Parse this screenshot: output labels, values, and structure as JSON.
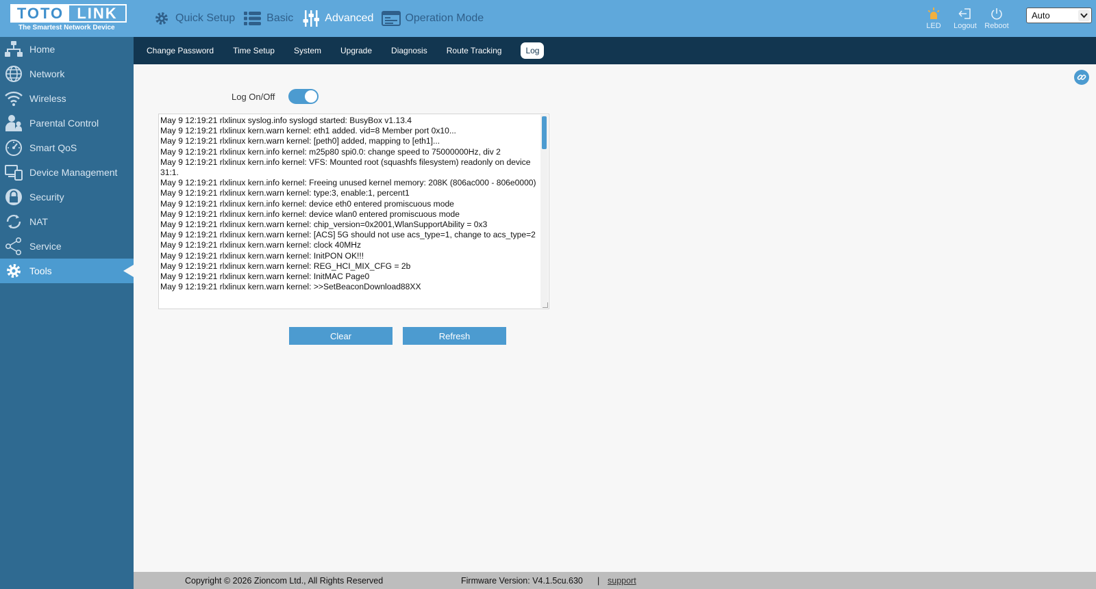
{
  "logo": {
    "left": "TOTO",
    "right": "LINK",
    "tagline": "The Smartest Network Device"
  },
  "topnav": [
    {
      "label": "Quick Setup",
      "icon": "gear-icon"
    },
    {
      "label": "Basic",
      "icon": "list-icon"
    },
    {
      "label": "Advanced",
      "icon": "sliders-icon"
    },
    {
      "label": "Operation Mode",
      "icon": "mode-icon"
    }
  ],
  "top_tools": {
    "led": "LED",
    "logout": "Logout",
    "reboot": "Reboot"
  },
  "language": {
    "selected": "Auto"
  },
  "sidebar": [
    {
      "label": "Home",
      "icon": "home-network-icon"
    },
    {
      "label": "Network",
      "icon": "globe-icon"
    },
    {
      "label": "Wireless",
      "icon": "wifi-icon"
    },
    {
      "label": "Parental Control",
      "icon": "parent-child-icon"
    },
    {
      "label": "Smart QoS",
      "icon": "speedometer-icon"
    },
    {
      "label": "Device Management",
      "icon": "devices-icon"
    },
    {
      "label": "Security",
      "icon": "lock-icon"
    },
    {
      "label": "NAT",
      "icon": "refresh-arrows-icon"
    },
    {
      "label": "Service",
      "icon": "share-icon"
    },
    {
      "label": "Tools",
      "icon": "gear-icon"
    }
  ],
  "subnav": [
    "Change Password",
    "Time Setup",
    "System",
    "Upgrade",
    "Diagnosis",
    "Route Tracking",
    "Log"
  ],
  "log": {
    "toggle_label": "Log On/Off",
    "enabled": true,
    "lines": [
      "May  9 12:19:21 rlxlinux syslog.info syslogd started: BusyBox v1.13.4",
      "May  9 12:19:21 rlxlinux kern.warn kernel: eth1 added. vid=8 Member port 0x10...",
      "May  9 12:19:21 rlxlinux kern.warn kernel: [peth0] added, mapping to [eth1]...",
      "May  9 12:19:21 rlxlinux kern.info kernel: m25p80 spi0.0: change speed to 75000000Hz, div 2",
      "May  9 12:19:21 rlxlinux kern.info kernel: VFS: Mounted root (squashfs filesystem) readonly on device 31:1.",
      "May  9 12:19:21 rlxlinux kern.info kernel: Freeing unused kernel memory: 208K (806ac000 - 806e0000)",
      "May  9 12:19:21 rlxlinux kern.warn kernel: type:3, enable:1, percent1",
      "May  9 12:19:21 rlxlinux kern.info kernel: device eth0 entered promiscuous mode",
      "May  9 12:19:21 rlxlinux kern.info kernel: device wlan0 entered promiscuous mode",
      "May  9 12:19:21 rlxlinux kern.warn kernel: chip_version=0x2001,WlanSupportAbility = 0x3",
      "May  9 12:19:21 rlxlinux kern.warn kernel: [ACS] 5G should not use acs_type=1, change to acs_type=2",
      "May  9 12:19:21 rlxlinux kern.warn kernel: clock 40MHz",
      "May  9 12:19:21 rlxlinux kern.warn kernel: InitPON OK!!!",
      "May  9 12:19:21 rlxlinux kern.warn kernel: REG_HCI_MIX_CFG = 2b",
      "May  9 12:19:21 rlxlinux kern.warn kernel: InitMAC Page0",
      "May  9 12:19:21 rlxlinux kern.warn kernel: >>SetBeaconDownload88XX"
    ]
  },
  "buttons": {
    "clear": "Clear",
    "refresh": "Refresh"
  },
  "footer": {
    "copyright": "Copyright © 2026 Zioncom Ltd., All Rights Reserved",
    "firmware": "Firmware Version: V4.1.5cu.630",
    "separator": "|",
    "support": "support"
  },
  "colors": {
    "header": "#5fa8db",
    "sidebar": "#2f6a91",
    "accent": "#4c9bd0",
    "subnav": "#123650",
    "led": "#f0b040"
  }
}
